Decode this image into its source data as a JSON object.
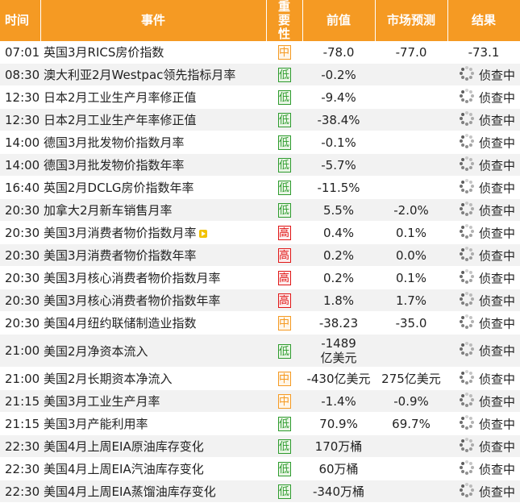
{
  "colors": {
    "header_bg": "#f59a23",
    "low": "#2e9b2e",
    "mid": "#f59a23",
    "high": "#e01818"
  },
  "header": {
    "time": "时间",
    "event": "事件",
    "importance": "重要性",
    "previous": "前值",
    "forecast": "市场预测",
    "result": "结果"
  },
  "rows": [
    {
      "time": "07:01",
      "event": "英国3月RICS房价指数",
      "importance": "中",
      "level": "mid",
      "previous": "-78.0",
      "forecast": "-77.0",
      "result": "-73.1",
      "pending": false
    },
    {
      "time": "08:30",
      "event": "澳大利亚2月Westpac领先指标月率",
      "importance": "低",
      "level": "low",
      "previous": "-0.2%",
      "forecast": "",
      "result": "侦查中",
      "pending": true
    },
    {
      "time": "12:30",
      "event": "日本2月工业生产月率修正值",
      "importance": "低",
      "level": "low",
      "previous": "-9.4%",
      "forecast": "",
      "result": "侦查中",
      "pending": true
    },
    {
      "time": "12:30",
      "event": "日本2月工业生产年率修正值",
      "importance": "低",
      "level": "low",
      "previous": "-38.4%",
      "forecast": "",
      "result": "侦查中",
      "pending": true
    },
    {
      "time": "14:00",
      "event": "德国3月批发物价指数月率",
      "importance": "低",
      "level": "low",
      "previous": "-0.1%",
      "forecast": "",
      "result": "侦查中",
      "pending": true
    },
    {
      "time": "14:00",
      "event": "德国3月批发物价指数年率",
      "importance": "低",
      "level": "low",
      "previous": "-5.7%",
      "forecast": "",
      "result": "侦查中",
      "pending": true
    },
    {
      "time": "16:40",
      "event": "英国2月DCLG房价指数年率",
      "importance": "低",
      "level": "low",
      "previous": "-11.5%",
      "forecast": "",
      "result": "侦查中",
      "pending": true
    },
    {
      "time": "20:30",
      "event": "加拿大2月新车销售月率",
      "importance": "低",
      "level": "low",
      "previous": "5.5%",
      "forecast": "-2.0%",
      "result": "侦查中",
      "pending": true
    },
    {
      "time": "20:30",
      "event": "美国3月消费者物价指数月率",
      "importance": "高",
      "level": "high",
      "previous": "0.4%",
      "forecast": "0.1%",
      "result": "侦查中",
      "pending": true,
      "play": true
    },
    {
      "time": "20:30",
      "event": "美国3月消费者物价指数年率",
      "importance": "高",
      "level": "high",
      "previous": "0.2%",
      "forecast": "0.0%",
      "result": "侦查中",
      "pending": true
    },
    {
      "time": "20:30",
      "event": "美国3月核心消费者物价指数月率",
      "importance": "高",
      "level": "high",
      "previous": "0.2%",
      "forecast": "0.1%",
      "result": "侦查中",
      "pending": true
    },
    {
      "time": "20:30",
      "event": "美国3月核心消费者物价指数年率",
      "importance": "高",
      "level": "high",
      "previous": "1.8%",
      "forecast": "1.7%",
      "result": "侦查中",
      "pending": true
    },
    {
      "time": "20:30",
      "event": "美国4月纽约联储制造业指数",
      "importance": "中",
      "level": "mid",
      "previous": "-38.23",
      "forecast": "-35.0",
      "result": "侦查中",
      "pending": true
    },
    {
      "time": "21:00",
      "event": "美国2月净资本流入",
      "importance": "低",
      "level": "low",
      "previous": "-1489亿美元",
      "forecast": "",
      "result": "侦查中",
      "pending": true,
      "tall": true
    },
    {
      "time": "21:00",
      "event": "美国2月长期资本净流入",
      "importance": "中",
      "level": "mid",
      "previous": "-430亿美元",
      "forecast": "275亿美元",
      "result": "侦查中",
      "pending": true
    },
    {
      "time": "21:15",
      "event": "美国3月工业生产月率",
      "importance": "中",
      "level": "mid",
      "previous": "-1.4%",
      "forecast": "-0.9%",
      "result": "侦查中",
      "pending": true
    },
    {
      "time": "21:15",
      "event": "美国3月产能利用率",
      "importance": "低",
      "level": "low",
      "previous": "70.9%",
      "forecast": "69.7%",
      "result": "侦查中",
      "pending": true
    },
    {
      "time": "22:30",
      "event": "美国4月上周EIA原油库存变化",
      "importance": "低",
      "level": "low",
      "previous": "170万桶",
      "forecast": "",
      "result": "侦查中",
      "pending": true
    },
    {
      "time": "22:30",
      "event": "美国4月上周EIA汽油库存变化",
      "importance": "低",
      "level": "low",
      "previous": "60万桶",
      "forecast": "",
      "result": "侦查中",
      "pending": true
    },
    {
      "time": "22:30",
      "event": "美国4月上周EIA蒸馏油库存变化",
      "importance": "低",
      "level": "low",
      "previous": "-340万桶",
      "forecast": "",
      "result": "侦查中",
      "pending": true
    }
  ]
}
